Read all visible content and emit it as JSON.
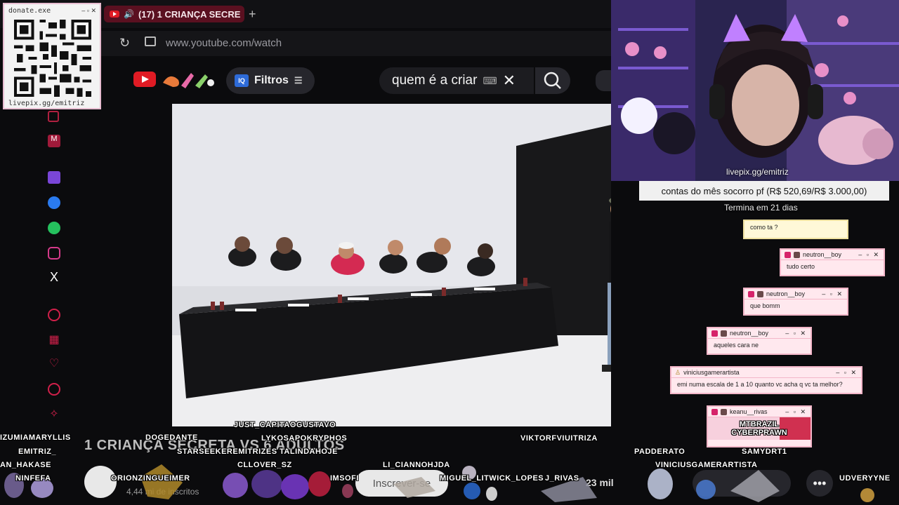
{
  "browser": {
    "tab_title": "(17) 1 CRIANÇA SECRE",
    "new_tab": "+",
    "url": "www.youtube.com/watch"
  },
  "youtube": {
    "filters_label": "Filtros",
    "iq_label": "IQ",
    "search_query": "quem é a criar",
    "video_title": "1 CRIANÇA SECRETA VS 6 ADULTOS",
    "channel_subs": "4,44 mi de inscritos",
    "subscribe_label": "Inscrever-se",
    "likes": "23 mil",
    "more_label": "•••"
  },
  "donate": {
    "title": "donate.exe",
    "controls": "– ▫ ✕",
    "url": "livepix.gg/emitriz"
  },
  "stream": {
    "cam_tag": "livepix.gg/emitriz",
    "goal_text": "contas do mês socorro pf (R$ 520,69/R$ 3.000,00)",
    "goal_sub": "Termina em 21 dias"
  },
  "chat": [
    {
      "user": "",
      "message": "como ta ?"
    },
    {
      "user": "neutron__boy",
      "message": "tudo certo"
    },
    {
      "user": "neutron__boy",
      "message": "que bomm"
    },
    {
      "user": "neutron__boy",
      "message": "aqueles cara ne"
    },
    {
      "user": "viniciusgamerartista",
      "message": "emi numa escala de 1 a 10 quanto vc acha q vc ta melhor?"
    },
    {
      "user": "keanu__rivas",
      "message": "MTBRAZIL CYBERPRAWN"
    }
  ],
  "chat_controls": "– ▫ ✕",
  "viewers": [
    "IZUMIAMARYLLIS",
    "EMITRIZ_",
    "AN_HAKASE",
    "NINFEFA",
    "DOGEDANTE",
    "JUST_CAPITAOGUSTAVO",
    "LYKOSAPOKRYPHOS",
    "STARSEEKEREMITRIZES",
    "TALINDAHOJE",
    "CLLOVER_SZ",
    "ORIONZINGUEIMER",
    "IMSOFI",
    "LI_CIANNOHJDA",
    "MIGUEL_LITWICK_LOPES",
    "J_RIVAS",
    "VIKTORFVIUITRIZA",
    "PADDERATO",
    "VINICIUSGAMERARTISTA",
    "SAMYDRT1",
    "UDVERYYNE"
  ],
  "colors": {
    "accent": "#d6236a",
    "chat_bg": "#ffe8ee",
    "tab_bg": "#5a1020"
  }
}
